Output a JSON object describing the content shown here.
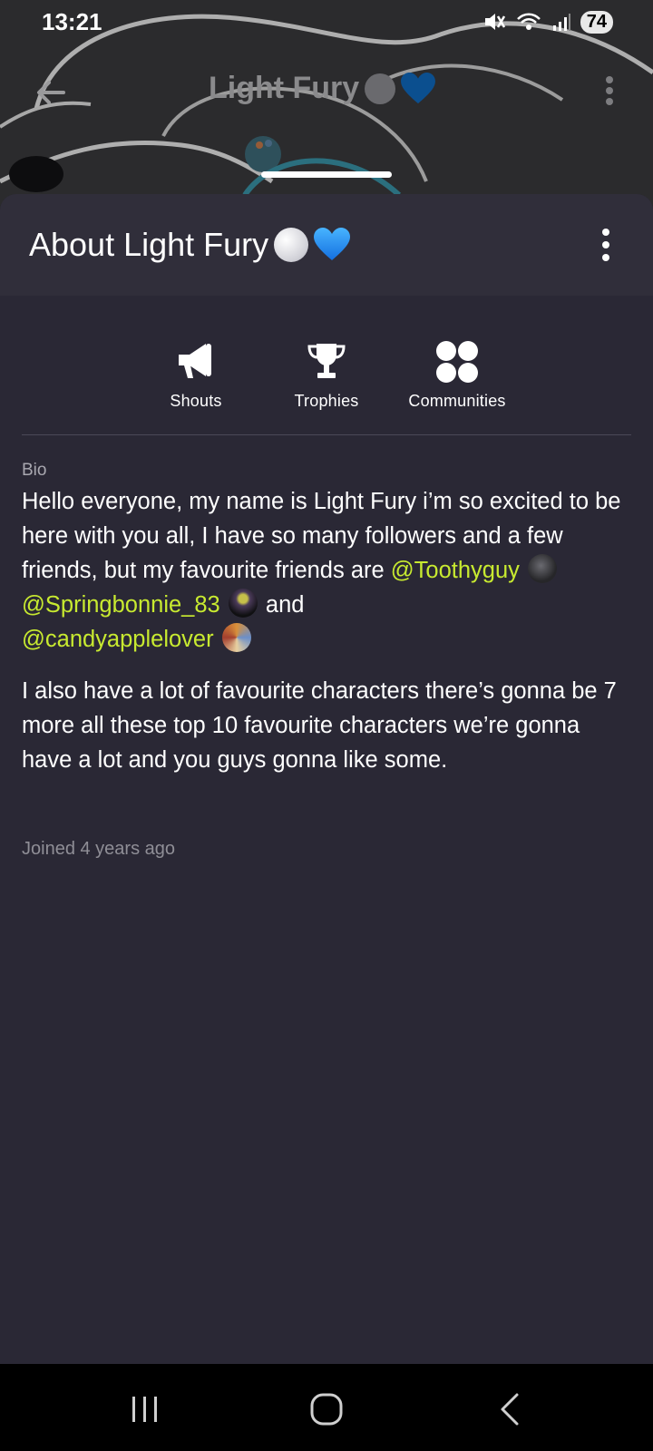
{
  "status_bar": {
    "time": "13:21",
    "battery": "74"
  },
  "top_bar": {
    "title": "Light Fury"
  },
  "sheet": {
    "title": "About Light Fury",
    "actions": [
      {
        "label": "Shouts",
        "icon": "megaphone-icon"
      },
      {
        "label": "Trophies",
        "icon": "trophy-icon"
      },
      {
        "label": "Communities",
        "icon": "communities-icon"
      }
    ]
  },
  "bio": {
    "label": "Bio",
    "p1_a": "Hello everyone, my name is Light Fury i’m so excited to be here with you all, I have so many followers and a few friends, but my favourite friends are",
    "mention1": "@Toothyguy",
    "mention2": "@Springbonnie_83",
    "and": "and",
    "mention3": "@candyapplelover",
    "p2": "I also have a lot of favourite characters there’s gonna be 7 more all these top 10 favourite characters we’re gonna have a lot and you guys gonna like some."
  },
  "joined": "Joined 4 years ago",
  "colors": {
    "sheet_bg": "#2a2835",
    "header_bg": "#302e3a",
    "mention": "#c8ea30"
  }
}
